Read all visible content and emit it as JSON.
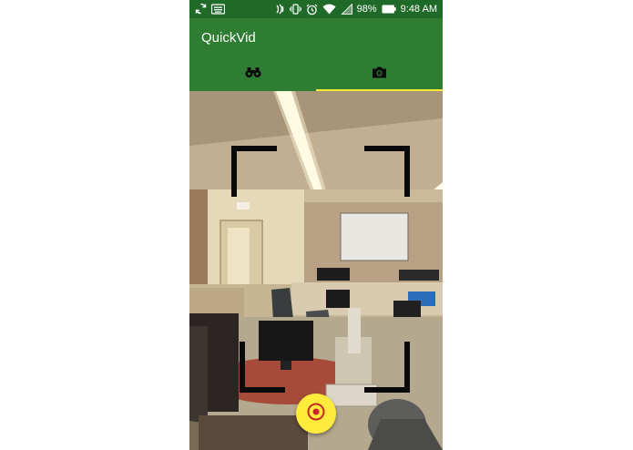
{
  "status_bar": {
    "battery_percent": "98%",
    "time": "9:48 AM",
    "icons_left": [
      "sync-icon",
      "keyboard-icon"
    ],
    "icons_right": [
      "nfc-icon",
      "vibrate-icon",
      "alarm-icon",
      "wifi-icon",
      "signal-icon",
      "battery-icon"
    ]
  },
  "app_bar": {
    "title": "QuickVid"
  },
  "tabs": [
    {
      "icon": "binoculars-icon",
      "selected": false
    },
    {
      "icon": "camera-icon",
      "selected": true
    }
  ],
  "colors": {
    "status_bar": "#1f6a28",
    "primary": "#2e7d32",
    "accent": "#ffeb3b",
    "record_ring": "#c62828"
  },
  "camera": {
    "record_button_icon": "record-icon"
  }
}
